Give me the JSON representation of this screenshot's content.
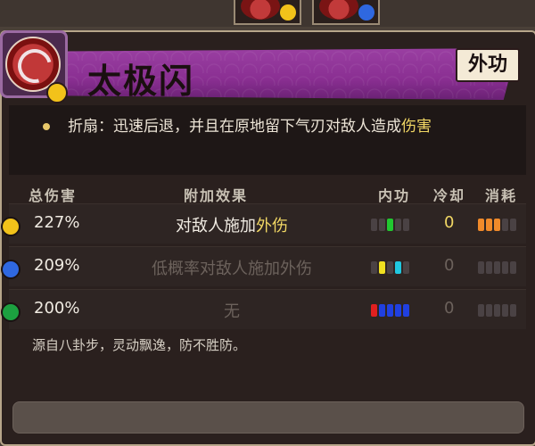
{
  "skill": {
    "title": "太极闪",
    "category": "外功",
    "description_prefix": "折扇：迅速后退，并且在原地留下气刃对敌人造成",
    "description_highlight": "伤害"
  },
  "table": {
    "headers": {
      "damage": "总伤害",
      "effect": "附加效果",
      "neigong": "内功",
      "cooldown": "冷却",
      "cost": "消耗"
    },
    "rows": [
      {
        "damage": "227%",
        "effect_prefix": "对敌人施加",
        "effect_highlight": "外伤",
        "cooldown": "0",
        "neigong_colors": [
          "#4a4244",
          "#4a4244",
          "#21c830",
          "#4a4244",
          "#4a4244"
        ],
        "cost_colors": [
          "#f08a2a",
          "#f08a2a",
          "#f08a2a",
          "#4a4244",
          "#4a4244"
        ],
        "dot_color": "#f2c21a"
      },
      {
        "damage": "209%",
        "effect_prefix": "低概率对敌人施加外伤",
        "effect_highlight": "",
        "cooldown": "0",
        "neigong_colors": [
          "#4a4244",
          "#f0e020",
          "#4a4244",
          "#20c8e0",
          "#4a4244"
        ],
        "cost_colors": [
          "#4a4244",
          "#4a4244",
          "#4a4244",
          "#4a4244",
          "#4a4244"
        ],
        "dot_color": "#2f68e0"
      },
      {
        "damage": "200%",
        "effect_prefix": "无",
        "effect_highlight": "",
        "cooldown": "0",
        "neigong_colors": [
          "#e02020",
          "#2040e0",
          "#2040e0",
          "#2040e0",
          "#2040e0"
        ],
        "cost_colors": [
          "#4a4244",
          "#4a4244",
          "#4a4244",
          "#4a4244",
          "#4a4244"
        ],
        "dot_color": "#1ca040"
      }
    ]
  },
  "source_text": "源自八卦步，灵动飘逸，防不胜防。",
  "colors": {
    "accent": "#8a2f92",
    "highlight": "#f1d764",
    "panel": "#2a201e"
  }
}
